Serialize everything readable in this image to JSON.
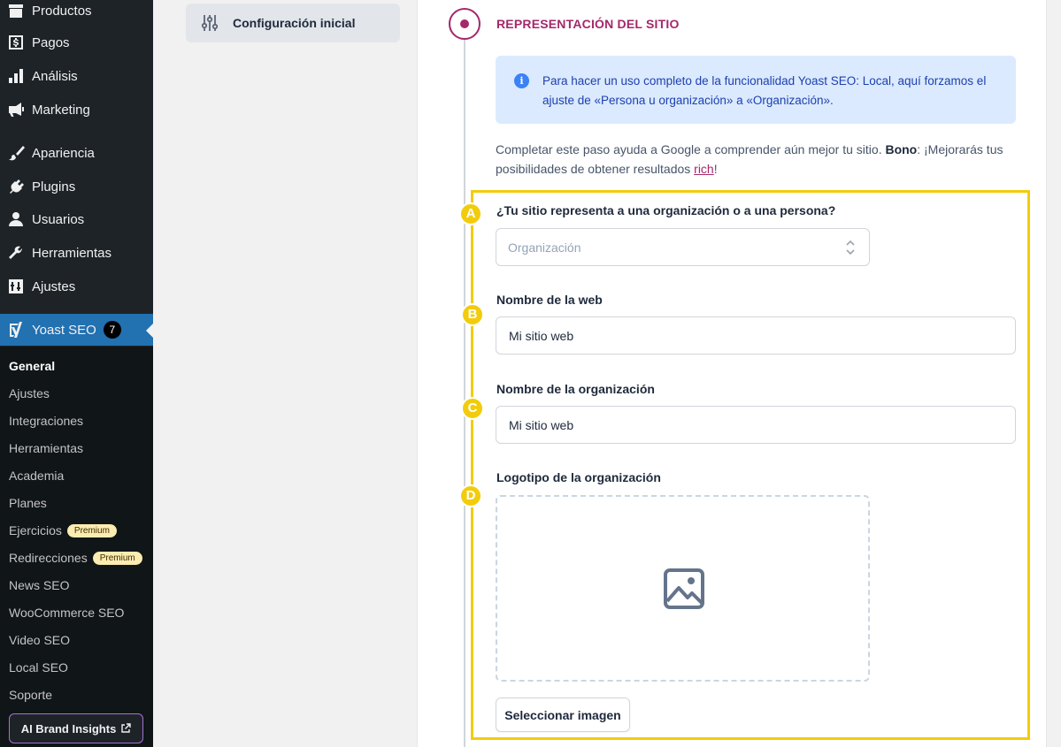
{
  "admin_menu": {
    "items": [
      {
        "label": "Productos",
        "icon": "archive-icon"
      },
      {
        "label": "Pagos",
        "icon": "dollar-icon"
      },
      {
        "label": "Análisis",
        "icon": "bar-chart-icon"
      },
      {
        "label": "Marketing",
        "icon": "megaphone-icon"
      },
      {
        "label": "Apariencia",
        "icon": "paintbrush-icon"
      },
      {
        "label": "Plugins",
        "icon": "plug-icon"
      },
      {
        "label": "Usuarios",
        "icon": "user-icon"
      },
      {
        "label": "Herramientas",
        "icon": "wrench-icon"
      },
      {
        "label": "Ajustes",
        "icon": "sliders-icon"
      }
    ],
    "yoast": {
      "label": "Yoast SEO",
      "badge": "7",
      "icon": "yoast-icon"
    },
    "submenu": [
      {
        "label": "General"
      },
      {
        "label": "Ajustes"
      },
      {
        "label": "Integraciones"
      },
      {
        "label": "Herramientas"
      },
      {
        "label": "Academia"
      },
      {
        "label": "Planes"
      },
      {
        "label": "Ejercicios",
        "badge": "Premium"
      },
      {
        "label": "Redirecciones",
        "badge": "Premium"
      },
      {
        "label": "News SEO"
      },
      {
        "label": "WooCommerce SEO"
      },
      {
        "label": "Video SEO"
      },
      {
        "label": "Local SEO"
      },
      {
        "label": "Soporte"
      }
    ],
    "brand_button": "AI Brand Insights"
  },
  "settings_nav": {
    "active_label": "Configuración inicial",
    "icon": "adjustments-icon"
  },
  "step": {
    "title": "REPRESENTACIÓN DEL SITIO"
  },
  "info_box": {
    "text": "Para hacer un uso completo de la funcionalidad Yoast SEO: Local, aquí forzamos el ajuste de «Persona u organización» a «Organización»."
  },
  "description": {
    "text": "Completar este paso ayuda a Google a comprender aún mejor tu sitio.",
    "bold": "Bono",
    "text2": ": ¡Mejorarás tus posibilidades de obtener resultados ",
    "link": "rich",
    "end": "!"
  },
  "markers": [
    "A",
    "B",
    "C",
    "D"
  ],
  "fields": {
    "site_type": {
      "label": "¿Tu sitio representa a una organización o a una persona?",
      "value": "Organización"
    },
    "site_name": {
      "label": "Nombre de la web",
      "value": "Mi sitio web"
    },
    "org_name": {
      "label": "Nombre de la organización",
      "value": "Mi sitio web"
    },
    "logo": {
      "label": "Logotipo de la organización",
      "button": "Seleccionar imagen"
    }
  },
  "colors": {
    "accent": "#a4286a",
    "highlight": "#f2cc0c",
    "admin_bg": "#1d2327",
    "yoast_active": "#2271b1"
  }
}
